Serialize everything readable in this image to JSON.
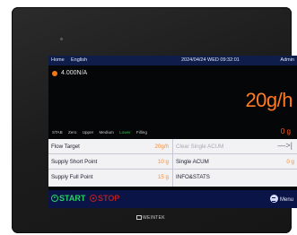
{
  "topbar": {
    "home": "Home",
    "language": "English",
    "datetime": "2024/04/24 WED 09:32:01",
    "user": "Admin"
  },
  "status": {
    "text": "4.000N/A",
    "dot_color": "#f07a1a"
  },
  "flow_rate": "20g/h",
  "modes": [
    "STAB",
    "Zero",
    "Upper",
    "Medium",
    "Lower",
    "Filling"
  ],
  "active_mode": "Lower",
  "current_weight": "0 g",
  "table": {
    "flow_target_label": "Flow Target",
    "flow_target_value": "20g/h",
    "clear_acum_label": "Clear Single ACUM",
    "clear_acum_arrow": "—>|",
    "short_point_label": "Supply Short Point",
    "short_point_value": "10 g",
    "single_acum_label": "Single ACUM",
    "single_acum_value": "0 g",
    "full_point_label": "Supply Full Point",
    "full_point_value": "15 g",
    "info_label": "INFO&STATS"
  },
  "buttons": {
    "start": "START",
    "stop": "STOP",
    "menu": "Menu"
  },
  "brand": "WEINTEK",
  "colors": {
    "accent_orange": "#ff7a22",
    "start_green": "#2ad06a",
    "stop_red": "#b02020",
    "bar_blue": "#0b1446"
  }
}
